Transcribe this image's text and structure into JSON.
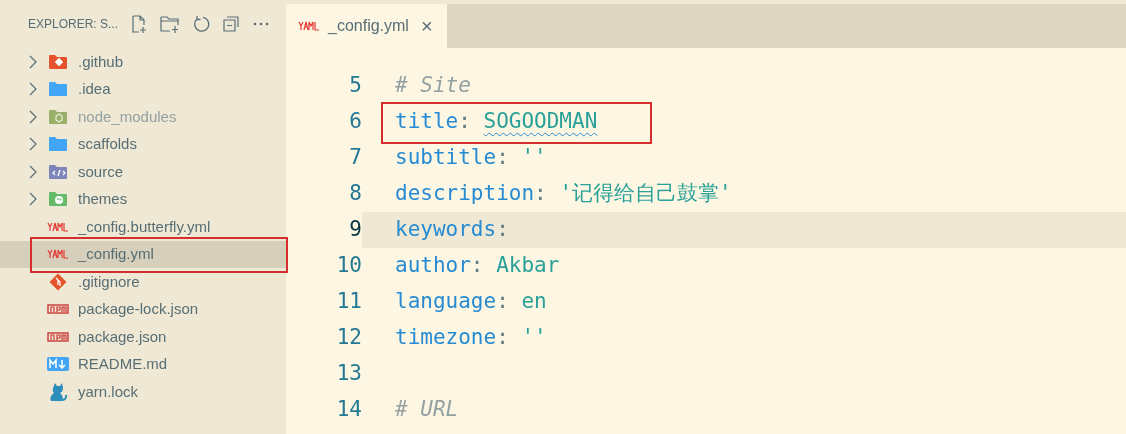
{
  "explorer": {
    "title": "EXPLORER: S...",
    "items": [
      {
        "label": ".github",
        "kind": "github",
        "dimmed": false,
        "selected": false,
        "annotated": false
      },
      {
        "label": ".idea",
        "kind": "folder",
        "dimmed": false,
        "selected": false,
        "annotated": false
      },
      {
        "label": "node_modules",
        "kind": "nodemodules",
        "dimmed": true,
        "selected": false,
        "annotated": false
      },
      {
        "label": "scaffolds",
        "kind": "folder",
        "dimmed": false,
        "selected": false,
        "annotated": false
      },
      {
        "label": "source",
        "kind": "source",
        "dimmed": false,
        "selected": false,
        "annotated": false
      },
      {
        "label": "themes",
        "kind": "themes",
        "dimmed": false,
        "selected": false,
        "annotated": false
      },
      {
        "label": "_config.butterfly.yml",
        "kind": "yaml",
        "dimmed": false,
        "selected": false,
        "annotated": false
      },
      {
        "label": "_config.yml",
        "kind": "yaml",
        "dimmed": false,
        "selected": true,
        "annotated": true
      },
      {
        "label": ".gitignore",
        "kind": "git",
        "dimmed": false,
        "selected": false,
        "annotated": false
      },
      {
        "label": "package-lock.json",
        "kind": "npm",
        "dimmed": false,
        "selected": false,
        "annotated": false
      },
      {
        "label": "package.json",
        "kind": "npm",
        "dimmed": false,
        "selected": false,
        "annotated": false
      },
      {
        "label": "README.md",
        "kind": "markdown",
        "dimmed": false,
        "selected": false,
        "annotated": false
      },
      {
        "label": "yarn.lock",
        "kind": "yarn",
        "dimmed": false,
        "selected": false,
        "annotated": false
      }
    ]
  },
  "tabs": [
    {
      "label": "_config.yml",
      "kind": "yaml",
      "selected": true,
      "close": "×"
    }
  ],
  "editor": {
    "lines": [
      {
        "number": "5",
        "current": false,
        "tokens": [
          {
            "kind": "comment",
            "text": "# Site"
          }
        ]
      },
      {
        "number": "6",
        "current": false,
        "annotated": true,
        "tokens": [
          {
            "kind": "key",
            "text": "title"
          },
          {
            "kind": "punct",
            "text": ": "
          },
          {
            "kind": "string",
            "text": "SOGOODMAN",
            "warning": true
          }
        ]
      },
      {
        "number": "7",
        "current": false,
        "tokens": [
          {
            "kind": "key",
            "text": "subtitle"
          },
          {
            "kind": "punct",
            "text": ": "
          },
          {
            "kind": "string",
            "text": "''"
          }
        ]
      },
      {
        "number": "8",
        "current": false,
        "tokens": [
          {
            "kind": "key",
            "text": "description"
          },
          {
            "kind": "punct",
            "text": ": "
          },
          {
            "kind": "string",
            "text": "'记得给自己鼓掌'"
          }
        ]
      },
      {
        "number": "9",
        "current": true,
        "tokens": [
          {
            "kind": "key",
            "text": "keywords"
          },
          {
            "kind": "punct",
            "text": ":"
          }
        ]
      },
      {
        "number": "10",
        "current": false,
        "tokens": [
          {
            "kind": "key",
            "text": "author"
          },
          {
            "kind": "punct",
            "text": ": "
          },
          {
            "kind": "string",
            "text": "Akbar"
          }
        ]
      },
      {
        "number": "11",
        "current": false,
        "tokens": [
          {
            "kind": "key",
            "text": "language"
          },
          {
            "kind": "punct",
            "text": ": "
          },
          {
            "kind": "string",
            "text": "en"
          }
        ]
      },
      {
        "number": "12",
        "current": false,
        "tokens": [
          {
            "kind": "key",
            "text": "timezone"
          },
          {
            "kind": "punct",
            "text": ": "
          },
          {
            "kind": "string",
            "text": "''"
          }
        ]
      },
      {
        "number": "13",
        "current": false
      },
      {
        "number": "14",
        "current": false,
        "tokens": [
          {
            "kind": "comment",
            "text": "# URL"
          }
        ]
      }
    ]
  }
}
